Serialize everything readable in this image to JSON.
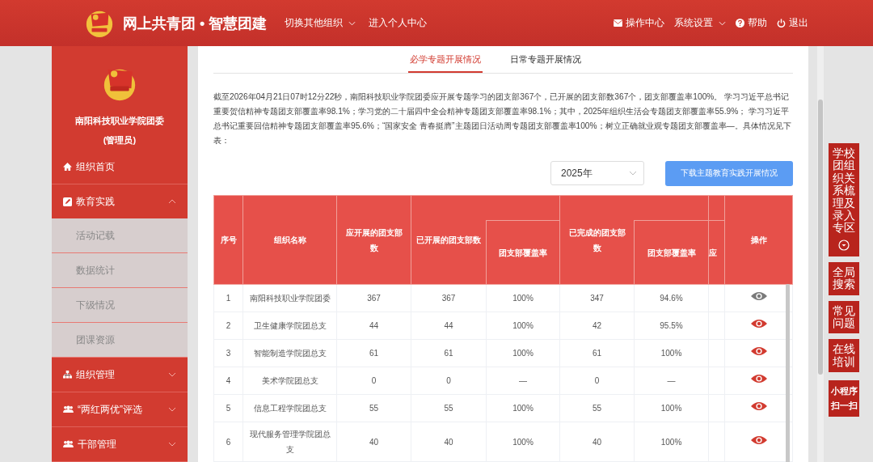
{
  "header": {
    "title": "网上共青团 • 智慧团建",
    "nav": [
      {
        "label": "切换其他组织",
        "dropdown": true
      },
      {
        "label": "进入个人中心",
        "dropdown": false
      }
    ],
    "right_nav": [
      {
        "label": "操作中心",
        "dropdown": false
      },
      {
        "label": "系统设置",
        "dropdown": true
      },
      {
        "label": "帮助",
        "dropdown": false
      },
      {
        "label": "退出",
        "dropdown": false
      }
    ]
  },
  "sidebar": {
    "org_name": "南阳科技职业学院团委",
    "role": "(管理员)",
    "items": [
      {
        "label": "组织首页",
        "expandable": false,
        "expanded": false
      },
      {
        "label": "教育实践",
        "expandable": true,
        "expanded": true,
        "children": [
          {
            "label": "活动记载"
          },
          {
            "label": "数据统计"
          },
          {
            "label": "下级情况"
          },
          {
            "label": "团课资源"
          }
        ]
      },
      {
        "label": "组织管理",
        "expandable": true,
        "expanded": false
      },
      {
        "label": "“两红两优”评选",
        "expandable": true,
        "expanded": false
      },
      {
        "label": "干部管理",
        "expandable": true,
        "expanded": false
      }
    ]
  },
  "tabs": [
    {
      "label": "必学专题开展情况",
      "selected": true
    },
    {
      "label": "日常专题开展情况",
      "selected": false
    }
  ],
  "summary": "截至2026年04月21日07时12分22秒，南阳科技职业学院团委应开展专题学习的团支部367个，已开展的团支部数367个，团支部覆盖率100%。 学习习近平总书记重要贺信精神专题团支部覆盖率98.1%；学习党的二十届四中全会精神专题团支部覆盖率98.1%；其中，2025年组织生活会专题团支部覆盖率55.9%； 学习习近平总书记重要回信精神专题团支部覆盖率95.6%；“国家安全 青春挺膺”主题团日活动周专题团支部覆盖率100%；树立正确就业观专题团支部覆盖率—。具体情况见下表：",
  "year_select": {
    "value": "2025年"
  },
  "download_button": "下载主题教育实践开展情况",
  "table": {
    "columns": {
      "index": "序号",
      "name": "组织名称",
      "should": "应开展的团支部数",
      "started": "已开展的团支部数",
      "started_rate": "团支部覆盖率",
      "done": "已完成的团支部数",
      "done_rate": "团支部覆盖率",
      "column_8": "应",
      "action": "操作"
    },
    "rows": [
      {
        "cells": [
          "1",
          "南阳科技职业学院团委",
          "367",
          "367",
          "100%",
          "347",
          "94.6%"
        ],
        "viewed": true
      },
      {
        "cells": [
          "2",
          "卫生健康学院团总支",
          "44",
          "44",
          "100%",
          "42",
          "95.5%"
        ],
        "viewed": false
      },
      {
        "cells": [
          "3",
          "智能制造学院团总支",
          "61",
          "61",
          "100%",
          "61",
          "100%"
        ],
        "viewed": false
      },
      {
        "cells": [
          "4",
          "美术学院团总支",
          "0",
          "0",
          "—",
          "0",
          "—"
        ],
        "viewed": false
      },
      {
        "cells": [
          "5",
          "信息工程学院团总支",
          "55",
          "55",
          "100%",
          "55",
          "100%"
        ],
        "viewed": false
      },
      {
        "cells": [
          "6",
          "现代服务管理学院团总支",
          "40",
          "40",
          "100%",
          "40",
          "100%"
        ],
        "viewed": false
      }
    ]
  },
  "float_buttons": [
    {
      "label": "学校团组织关系梳理及录入专区",
      "kind": "expand"
    },
    {
      "label": "全局搜索",
      "kind": "plain"
    },
    {
      "label": "常见问题",
      "kind": "plain"
    },
    {
      "label": "在线培训",
      "kind": "plain"
    },
    {
      "label": "小程序扫一扫",
      "kind": "bold"
    }
  ]
}
